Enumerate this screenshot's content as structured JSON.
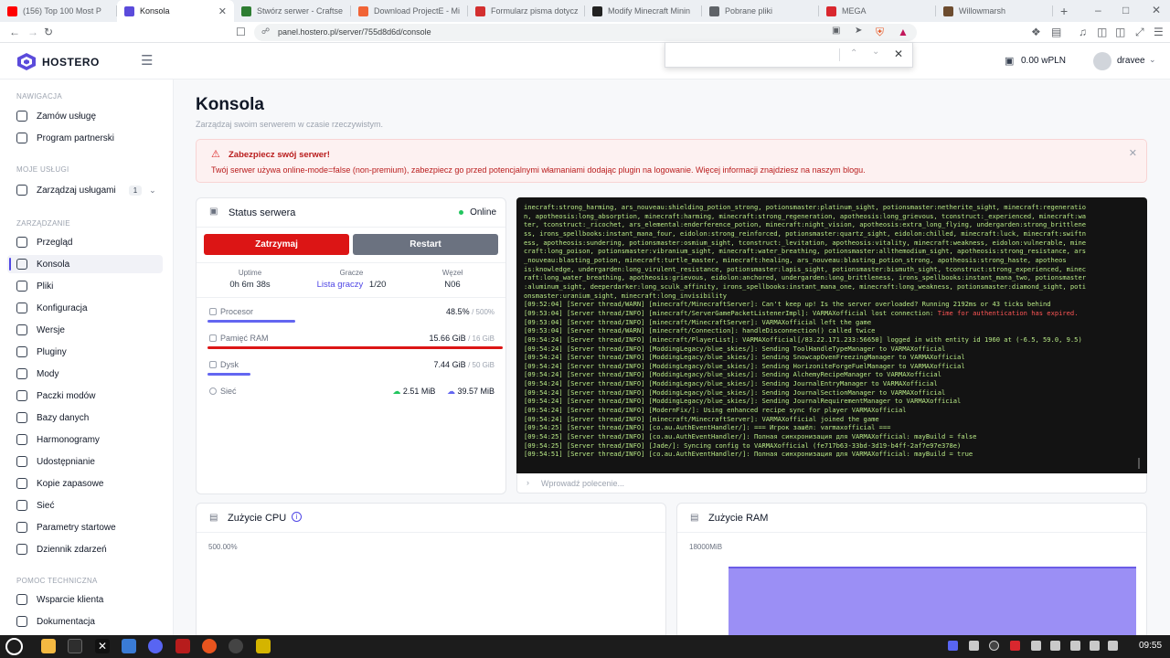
{
  "browser": {
    "tabs": [
      {
        "label": "(156) Top 100 Most P",
        "color": "#ff0000"
      },
      {
        "label": "Konsola",
        "color": "#5b4bdb",
        "active": true
      },
      {
        "label": "Stwórz serwer - Craftse",
        "color": "#2e7d32"
      },
      {
        "label": "Download ProjectE - Mi",
        "color": "#f16436"
      },
      {
        "label": "Formularz pisma dotycz",
        "color": "#d32f2f"
      },
      {
        "label": "Modify Minecraft Minin",
        "color": "#222222"
      },
      {
        "label": "Pobrane pliki",
        "color": "#5f6368"
      },
      {
        "label": "MEGA",
        "color": "#d9272e"
      },
      {
        "label": "Willowmarsh",
        "color": "#6d4c2f"
      }
    ],
    "url": "panel.hostero.pl/server/755d8d6d/console"
  },
  "header": {
    "logo_text": "HOSTERO",
    "balance": "0.00 wPLN",
    "username": "dravee"
  },
  "sidebar": {
    "sections": [
      {
        "title": "NAWIGACJA",
        "items": [
          {
            "label": "Zamów usługę"
          },
          {
            "label": "Program partnerski"
          }
        ]
      },
      {
        "title": "MOJE USŁUGI",
        "items": [
          {
            "label": "Zarządzaj usługami",
            "badge": "1"
          }
        ]
      },
      {
        "title": "ZARZĄDZANIE",
        "items": [
          {
            "label": "Przegląd"
          },
          {
            "label": "Konsola",
            "active": true
          },
          {
            "label": "Pliki"
          },
          {
            "label": "Konfiguracja"
          },
          {
            "label": "Wersje"
          },
          {
            "label": "Pluginy"
          },
          {
            "label": "Mody"
          },
          {
            "label": "Paczki modów"
          },
          {
            "label": "Bazy danych"
          },
          {
            "label": "Harmonogramy"
          },
          {
            "label": "Udostępnianie"
          },
          {
            "label": "Kopie zapasowe"
          },
          {
            "label": "Sieć"
          },
          {
            "label": "Parametry startowe"
          },
          {
            "label": "Dziennik zdarzeń"
          }
        ]
      },
      {
        "title": "POMOC TECHNICZNA",
        "items": [
          {
            "label": "Wsparcie klienta"
          },
          {
            "label": "Dokumentacja"
          }
        ]
      }
    ]
  },
  "page": {
    "title": "Konsola",
    "subtitle": "Zarządzaj swoim serwerem w czasie rzeczywistym."
  },
  "alert": {
    "title": "Zabezpiecz swój serwer!",
    "text": "Twój serwer używa online-mode=false (non-premium), zabezpiecz go przed potencjalnymi włamaniami dodając plugin na logowanie. Więcej informacji znajdziesz na naszym blogu.",
    "color": "#dc2626"
  },
  "status": {
    "title": "Status serwera",
    "state": "Online",
    "stop_label": "Zatrzymaj",
    "restart_label": "Restart",
    "uptime_label": "Uptime",
    "uptime_value": "0h 6m 38s",
    "players_label": "Gracze",
    "players_link": "Lista graczy",
    "players_value": "1/20",
    "node_label": "Węzeł",
    "node_value": "N06",
    "cpu_label": "Procesor",
    "cpu_value": "48.5%",
    "cpu_max": "/ 500%",
    "cpu_fraction": 0.097,
    "ram_label": "Pamięć RAM",
    "ram_value": "15.66 GiB",
    "ram_max": "/ 16 GiB",
    "ram_fraction": 0.979,
    "disk_label": "Dysk",
    "disk_value": "7.44 GiB",
    "disk_max": "/ 50 GiB",
    "disk_fraction": 0.149,
    "net_label": "Sieć",
    "net_down": "2.51 MiB",
    "net_up": "39.57 MiB"
  },
  "console": {
    "lines": [
      "inecraft:strong_harming, ars_nouveau:shielding_potion_strong, potionsmaster:platinum_sight, potionsmaster:netherite_sight, minecraft:regeneratio",
      "n, apotheosis:long_absorption, minecraft:harming, minecraft:strong_regeneration, apotheosis:long_grievous, tconstruct:_experienced, minecraft:wa",
      "ter, tconstruct:_ricochet, ars_elemental:enderference_potion, minecraft:night_vision, apotheosis:extra_long_flying, undergarden:strong_brittlene",
      "ss, irons_spellbooks:instant_mana_four, eidolon:strong_reinforced, potionsmaster:quartz_sight, eidolon:chilled, minecraft:luck, minecraft:swiftn",
      "ess, apotheosis:sundering, potionsmaster:osmium_sight, tconstruct:_levitation, apotheosis:vitality, minecraft:weakness, eidolon:vulnerable, mine",
      "craft:long_poison, potionsmaster:vibranium_sight, minecraft:water_breathing, potionsmaster:allthemodium_sight, apotheosis:strong_resistance, ars",
      "_nouveau:blasting_potion, minecraft:turtle_master, minecraft:healing, ars_nouveau:blasting_potion_strong, apotheosis:strong_haste, apotheos",
      "is:knowledge, undergarden:long_virulent_resistance, potionsmaster:lapis_sight, potionsmaster:bismuth_sight, tconstruct:strong_experienced, minec",
      "raft:long_water_breathing, apotheosis:grievous, eidolon:anchored, undergarden:long_brittleness, irons_spellbooks:instant_mana_two, potionsmaster",
      ":aluminum_sight, deeperdarker:long_sculk_affinity, irons_spellbooks:instant_mana_one, minecraft:long_weakness, potionsmaster:diamond_sight, poti",
      "onsmaster:uranium_sight, minecraft:long_invisibility",
      "[09:52:04] [Server thread/WARN] [minecraft/MinecraftServer]: Can't keep up! Is the server overloaded? Running 2192ms or 43 ticks behind",
      "[09:53:04] [Server thread/INFO] [minecraft/ServerGamePacketListenerImpl]: VARMAXofficial lost connection: ",
      "[09:53:04] [Server thread/INFO] [minecraft/MinecraftServer]: VARMAXofficial left the game",
      "[09:53:04] [Server thread/WARN] [minecraft/Connection]: handleDisconnection() called twice",
      "[09:54:24] [Server thread/INFO] [minecraft/PlayerList]: VARMAXofficial[/83.22.171.233:56650] logged in with entity id 1960 at (-6.5, 59.0, 9.5)",
      "[09:54:24] [Server thread/INFO] [ModdingLegacy/blue_skies/]: Sending ToolHandleTypeManager to VARMAXofficial",
      "[09:54:24] [Server thread/INFO] [ModdingLegacy/blue_skies/]: Sending SnowcapOvenFreezingManager to VARMAXofficial",
      "[09:54:24] [Server thread/INFO] [ModdingLegacy/blue_skies/]: Sending HorizoniteForgeFuelManager to VARMAXofficial",
      "[09:54:24] [Server thread/INFO] [ModdingLegacy/blue_skies/]: Sending AlchemyRecipeManager to VARMAXofficial",
      "[09:54:24] [Server thread/INFO] [ModdingLegacy/blue_skies/]: Sending JournalEntryManager to VARMAXofficial",
      "[09:54:24] [Server thread/INFO] [ModdingLegacy/blue_skies/]: Sending JournalSectionManager to VARMAXofficial",
      "[09:54:24] [Server thread/INFO] [ModdingLegacy/blue_skies/]: Sending JournalRequirementManager to VARMAXofficial",
      "[09:54:24] [Server thread/INFO] [ModernFix/]: Using enhanced recipe sync for player VARMAXofficial",
      "[09:54:24] [Server thread/INFO] [minecraft/MinecraftServer]: VARMAXofficial joined the game",
      "[09:54:25] [Server thread/INFO] [co.au.AuthEventHandler/]: === Игрок зашёл: varmaxofficial ===",
      "[09:54:25] [Server thread/INFO] [co.au.AuthEventHandler/]: Полная синхронизация для VARMAXofficial: mayBuild = false",
      "[09:54:25] [Server thread/INFO] [Jade/]: Syncing config to VARMAXofficial (fe717b63-33bd-3d19-b4ff-2af7e97e378e)",
      "[09:54:51] [Server thread/INFO] [co.au.AuthEventHandler/]: Полная синхронизация для VARMAXofficial: mayBuild = true"
    ],
    "error_fragment": "Time for authentication has expired.",
    "input_placeholder": "Wprowadź polecenie..."
  },
  "charts": {
    "cpu_title": "Zużycie CPU",
    "cpu_axis": "500.00%",
    "ram_title": "Zużycie RAM",
    "ram_axis": "18000MiB",
    "ram_fill_color": "#9b8ff5"
  },
  "taskbar": {
    "time": "09:55"
  }
}
